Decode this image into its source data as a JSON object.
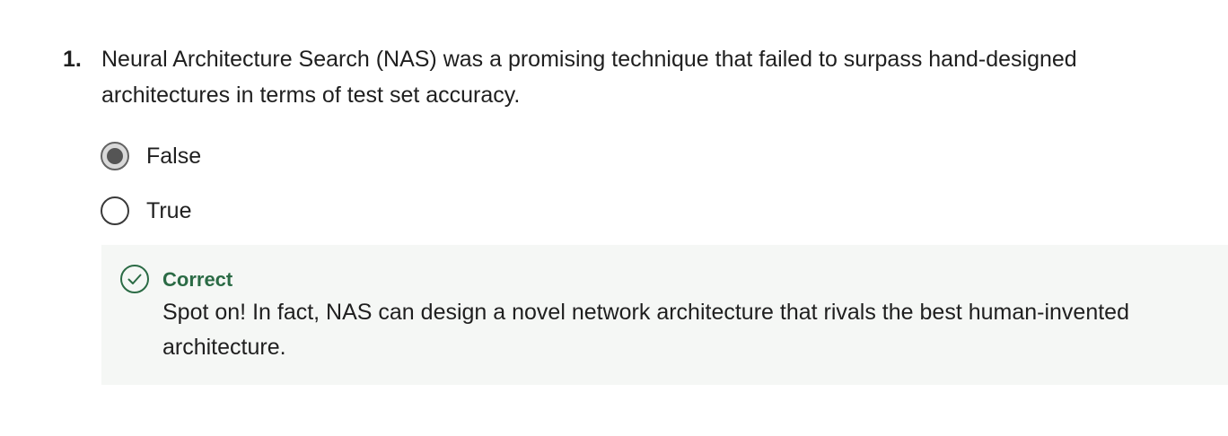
{
  "question": {
    "number": "1.",
    "text": "Neural Architecture Search (NAS) was a promising technique that failed to surpass hand-designed architectures in terms of test set accuracy.",
    "options": [
      {
        "label": "False",
        "selected": true
      },
      {
        "label": "True",
        "selected": false
      }
    ]
  },
  "feedback": {
    "status": "Correct",
    "icon": "check-circle-icon",
    "message": "Spot on! In fact, NAS can design a novel network architecture that rivals the best human-invented architecture.",
    "accent_color": "#2b6b45",
    "background_color": "#f5f7f5"
  }
}
